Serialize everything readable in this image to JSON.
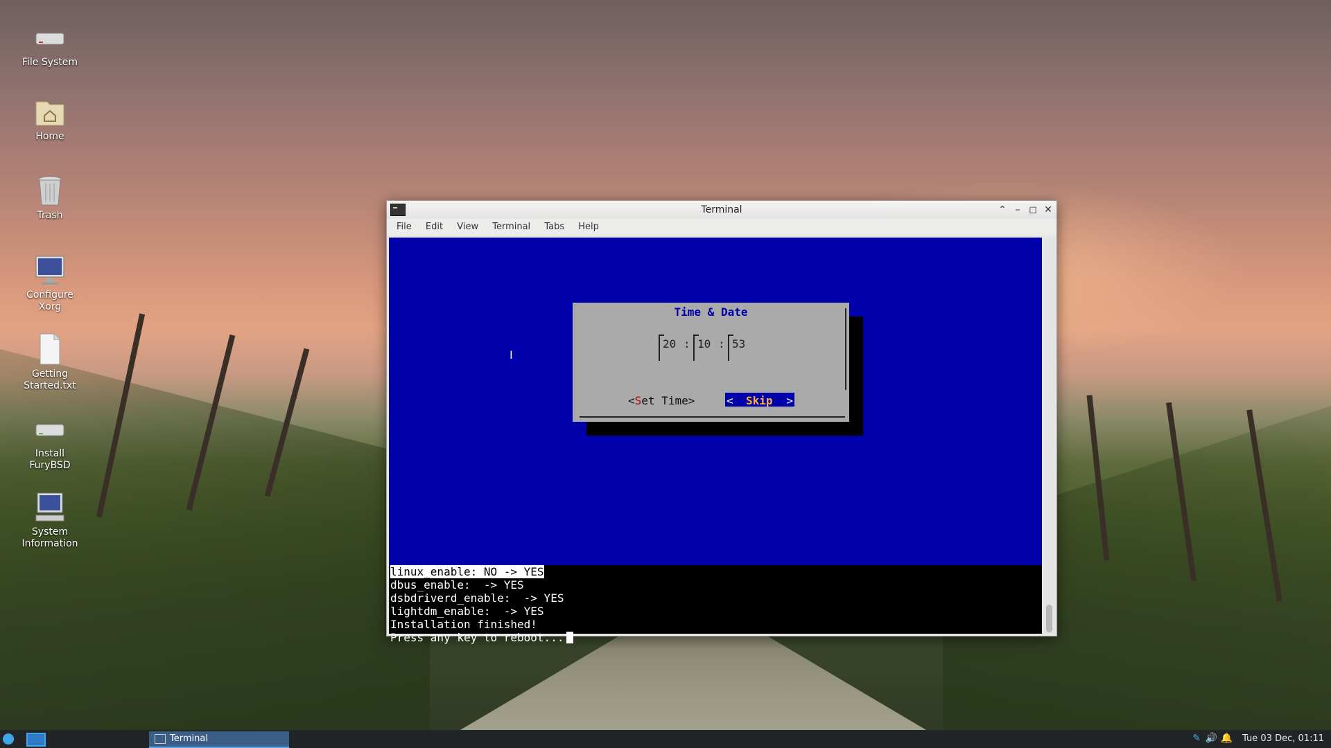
{
  "desktop": {
    "icons": [
      {
        "label": "File System",
        "icon": "drive-icon"
      },
      {
        "label": "Home",
        "icon": "home-folder-icon"
      },
      {
        "label": "Trash",
        "icon": "trash-icon"
      },
      {
        "label": "Configure Xorg",
        "icon": "monitor-icon"
      },
      {
        "label": "Getting Started.txt",
        "icon": "text-file-icon"
      },
      {
        "label": "Install FuryBSD",
        "icon": "drive-icon"
      },
      {
        "label": "System Information",
        "icon": "computer-icon"
      }
    ]
  },
  "window": {
    "title": "Terminal",
    "menu": [
      "File",
      "Edit",
      "View",
      "Terminal",
      "Tabs",
      "Help"
    ]
  },
  "dialog": {
    "title": "Time & Date",
    "hour": "20",
    "minute": "10",
    "second": "53",
    "colon": ":",
    "set_time_open": "<",
    "set_time_hot": "S",
    "set_time_rest": "et Time>",
    "skip_left": "<",
    "skip_label": "Skip",
    "skip_right": ">"
  },
  "console": {
    "lines": [
      "linux_enable: NO -> YES",
      "dbus_enable:  -> YES",
      "dsbdriverd_enable:  -> YES",
      "lightdm_enable:  -> YES",
      "Installation finished!",
      "Press any key to reboot..."
    ]
  },
  "taskbar": {
    "task_label": "Terminal",
    "clock": "Tue 03 Dec, 01:11"
  },
  "colors": {
    "terminal_bg": "#0000aa",
    "dialog_bg": "#aaaaaa",
    "accent": "#3fa7e6"
  }
}
